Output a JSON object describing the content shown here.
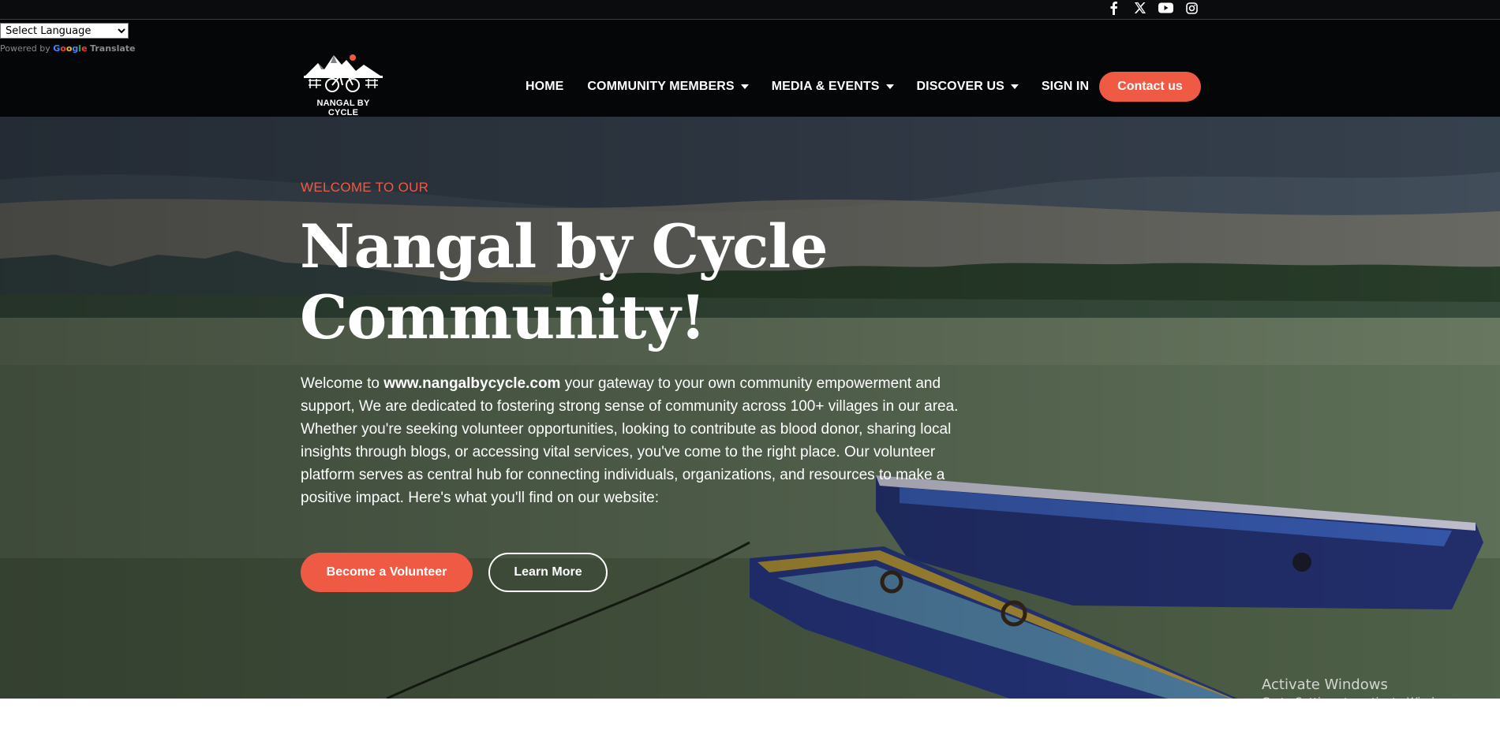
{
  "social": {
    "icons": [
      "facebook-icon",
      "x-twitter-icon",
      "youtube-icon",
      "instagram-icon"
    ]
  },
  "translate": {
    "select_value": "Select Language",
    "powered_by": "Powered by",
    "google": "Google",
    "translate": "Translate"
  },
  "brand": {
    "logo_text": "NANGAL BY CYCLE"
  },
  "nav": {
    "home": "HOME",
    "community": "COMMUNITY MEMBERS",
    "media": "MEDIA & EVENTS",
    "discover": "DISCOVER US",
    "signin": "SIGN IN",
    "contact": "Contact us"
  },
  "hero": {
    "eyebrow": "WELCOME TO OUR",
    "title_line1": "Nangal by Cycle",
    "title_line2": "Community!",
    "intro_prefix": "Welcome to ",
    "intro_site": "www.nangalbycycle.com",
    "intro_rest": " your gateway to your own community empowerment and support, We are dedicated to fostering strong sense of community across 100+ villages in our area. Whether you're seeking volunteer opportunities, looking to contribute as blood donor, sharing local insights through blogs, or accessing vital services, you've come to the right place. Our volunteer platform serves as central hub for connecting individuals, organizations, and resources to make a positive impact. Here's what you'll find on our website:",
    "btn_volunteer": "Become a Volunteer",
    "btn_learn": "Learn More"
  },
  "watermark": {
    "line1": "Activate Windows",
    "line2": "Go to Settings to activate Windows."
  },
  "colors": {
    "accent": "#ef5a44",
    "header_bg": "#050607"
  }
}
